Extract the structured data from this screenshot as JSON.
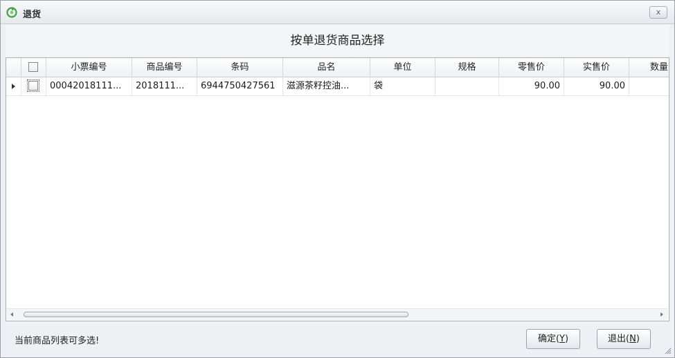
{
  "window": {
    "title": "退货",
    "close_label": "x"
  },
  "heading": "按单退货商品选择",
  "grid": {
    "columns": [
      "小票编号",
      "商品编号",
      "条码",
      "品名",
      "单位",
      "规格",
      "零售价",
      "实售价",
      "数量"
    ],
    "rows": [
      {
        "ticket_no": "00042018111...",
        "product_no": "2018111...",
        "barcode": "6944750427561",
        "name": "滋源茶籽控油...",
        "unit": "袋",
        "spec": "",
        "retail_price": "90.00",
        "actual_price": "90.00",
        "qty": ""
      }
    ]
  },
  "footer": {
    "status_text": "当前商品列表可多选!",
    "confirm_label": "确定(",
    "confirm_key": "Y",
    "confirm_close": ")",
    "exit_label": "退出(",
    "exit_key": "N",
    "exit_close": ")"
  },
  "icons": {
    "app": "recycle-icon",
    "close": "close-icon",
    "row_indicator": "row-arrow-icon",
    "scroll_left": "chevron-left-icon",
    "scroll_right": "chevron-right-icon",
    "resize": "resize-grip-icon"
  },
  "colors": {
    "accent_green": "#3aa53a",
    "window_bg": "#eef0f3"
  }
}
